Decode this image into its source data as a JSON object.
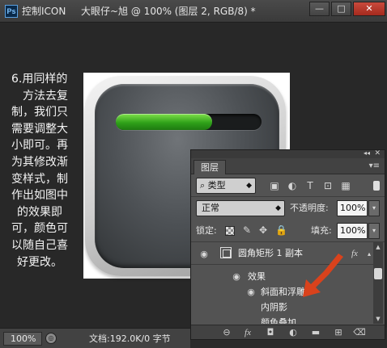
{
  "window": {
    "app_logo": "Ps",
    "app_title": "控制ICON",
    "doc_title": "大眼仔~旭 @ 100% (图层 2, RGB/8) *",
    "minimize_label": "—",
    "maximize_label": "□",
    "close_label": "✕"
  },
  "tutorial": {
    "lines": [
      "6.用同样的",
      "方法去复",
      "制，我们只",
      "需要调整大",
      "小即可。再",
      "为其修改渐",
      "变样式，制",
      "作出如图中",
      "的效果即",
      "可，颜色可",
      "以随自己喜",
      "好更改。"
    ]
  },
  "icon_preview": {
    "progress_fraction": 0.66,
    "fill_color": "#2fa11a"
  },
  "layers_panel": {
    "collapse_glyph": "◂◂",
    "close_glyph": "✕",
    "tab_label": "图层",
    "menu_glyph": "▾≡",
    "filter": {
      "search_glyph": "⌕",
      "kind_label": "类型",
      "kind_arrow": "◆",
      "icons": [
        "▣",
        "◐",
        "T",
        "⊡",
        "▦"
      ]
    },
    "blend": {
      "mode": "正常",
      "mode_arrow": "◆",
      "opacity_label": "不透明度:",
      "opacity_value": "100%",
      "opacity_arrow": "▾"
    },
    "lock": {
      "label": "锁定:",
      "icons": [
        "✎",
        "✥",
        "🔒"
      ],
      "fill_label": "填充:",
      "fill_value": "100%",
      "fill_arrow": "▾"
    },
    "layer": {
      "eye_glyph": "◉",
      "name": "圆角矩形 1 副本",
      "fx": "fx",
      "expand_glyph": "▴"
    },
    "effects": {
      "eye_glyph": "◉",
      "header": "效果",
      "items": [
        "斜面和浮雕",
        "内阴影",
        "颜色叠加"
      ]
    },
    "scroll_up": "▲",
    "scroll_down": "▼",
    "bottom_icons": [
      "⊖",
      "fx",
      "◘",
      "◐",
      "▬",
      "⊞",
      "⌫"
    ]
  },
  "statusbar": {
    "zoom": "100%",
    "info_glyph": "◎",
    "doc_info": "文档:192.0K/0 字节"
  },
  "annotation": {
    "arrow_color": "#d9421c"
  }
}
